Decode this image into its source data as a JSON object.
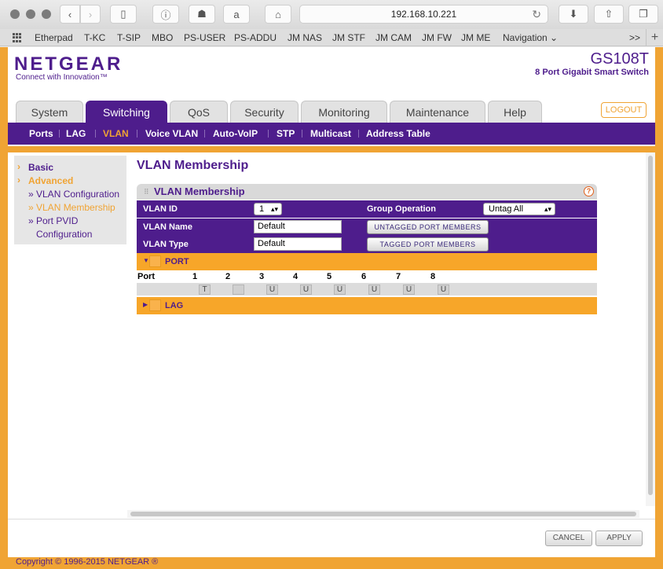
{
  "browser": {
    "url": "192.168.10.221",
    "bookmarks": [
      "Etherpad",
      "T-KC",
      "T-SIP",
      "MBO",
      "PS-USER",
      "PS-ADDU",
      "JM NAS",
      "JM STF",
      "JM CAM",
      "JM FW",
      "JM ME",
      "Navigation ⌄"
    ],
    "more_label": ">>",
    "add_label": "+"
  },
  "header": {
    "logo": "NETGEAR",
    "tagline": "Connect with Innovation™",
    "model": "GS108T",
    "model_desc": "8 Port Gigabit Smart Switch",
    "logout": "LOGOUT"
  },
  "tabs": [
    "System",
    "Switching",
    "QoS",
    "Security",
    "Monitoring",
    "Maintenance",
    "Help"
  ],
  "active_tab": "Switching",
  "subnav": [
    "Ports",
    "LAG",
    "VLAN",
    "Voice VLAN",
    "Auto-VoIP",
    "STP",
    "Multicast",
    "Address Table"
  ],
  "active_subnav": "VLAN",
  "sidebar": {
    "basic": "Basic",
    "advanced": "Advanced",
    "items": [
      "» VLAN Configuration",
      "» VLAN Membership",
      "» Port PVID",
      "Configuration"
    ]
  },
  "main": {
    "title": "VLAN Membership",
    "panel_title": "VLAN Membership",
    "help": "?",
    "vlan_id_label": "VLAN ID",
    "vlan_id_value": "1",
    "group_op_label": "Group Operation",
    "group_op_value": "Untag All",
    "vlan_name_label": "VLAN Name",
    "vlan_name_value": "Default",
    "vlan_type_label": "VLAN Type",
    "vlan_type_value": "Default",
    "untagged_btn": "UNTAGGED PORT MEMBERS",
    "tagged_btn": "TAGGED PORT MEMBERS",
    "port_section": "PORT",
    "lag_section": "LAG",
    "port_header": "Port",
    "ports": [
      "1",
      "2",
      "3",
      "4",
      "5",
      "6",
      "7",
      "8"
    ],
    "port_states": [
      "T",
      "",
      "U",
      "U",
      "U",
      "U",
      "U",
      "U"
    ]
  },
  "footer": {
    "cancel": "CANCEL",
    "apply": "APPLY",
    "copyright": "Copyright © 1996-2015 NETGEAR ®"
  }
}
